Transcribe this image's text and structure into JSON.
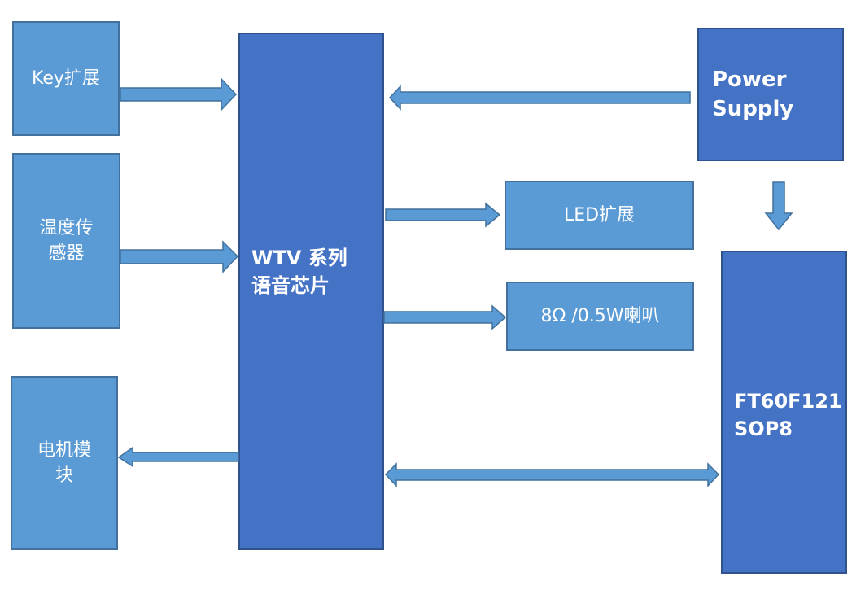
{
  "diagram": {
    "nodes": {
      "key_ext": {
        "label": "Key扩展"
      },
      "temp_sensor": {
        "label": "温度传\n感器"
      },
      "motor_module": {
        "label": "电机模\n块"
      },
      "voice_chip": {
        "label": "WTV 系列\n语音芯片"
      },
      "led_ext": {
        "label": "LED扩展"
      },
      "speaker": {
        "label": "8Ω /0.5W喇叭"
      },
      "power_supply": {
        "label": "Power\nSupply"
      },
      "mcu": {
        "label": "FT60F121\nSOP8"
      }
    },
    "edges": [
      {
        "from": "key_ext",
        "to": "voice_chip",
        "direction": "right"
      },
      {
        "from": "temp_sensor",
        "to": "voice_chip",
        "direction": "right"
      },
      {
        "from": "voice_chip",
        "to": "motor_module",
        "direction": "left"
      },
      {
        "from": "power_supply",
        "to": "voice_chip",
        "direction": "left"
      },
      {
        "from": "voice_chip",
        "to": "led_ext",
        "direction": "right"
      },
      {
        "from": "voice_chip",
        "to": "speaker",
        "direction": "right"
      },
      {
        "from": "power_supply",
        "to": "mcu",
        "direction": "down"
      },
      {
        "from": "voice_chip",
        "to": "mcu",
        "direction": "bidirectional"
      }
    ],
    "colors": {
      "peripheral_fill": "#5b9bd5",
      "core_fill": "#4472c4",
      "arrow_fill": "#5b9bd5",
      "text": "#ffffff"
    }
  }
}
